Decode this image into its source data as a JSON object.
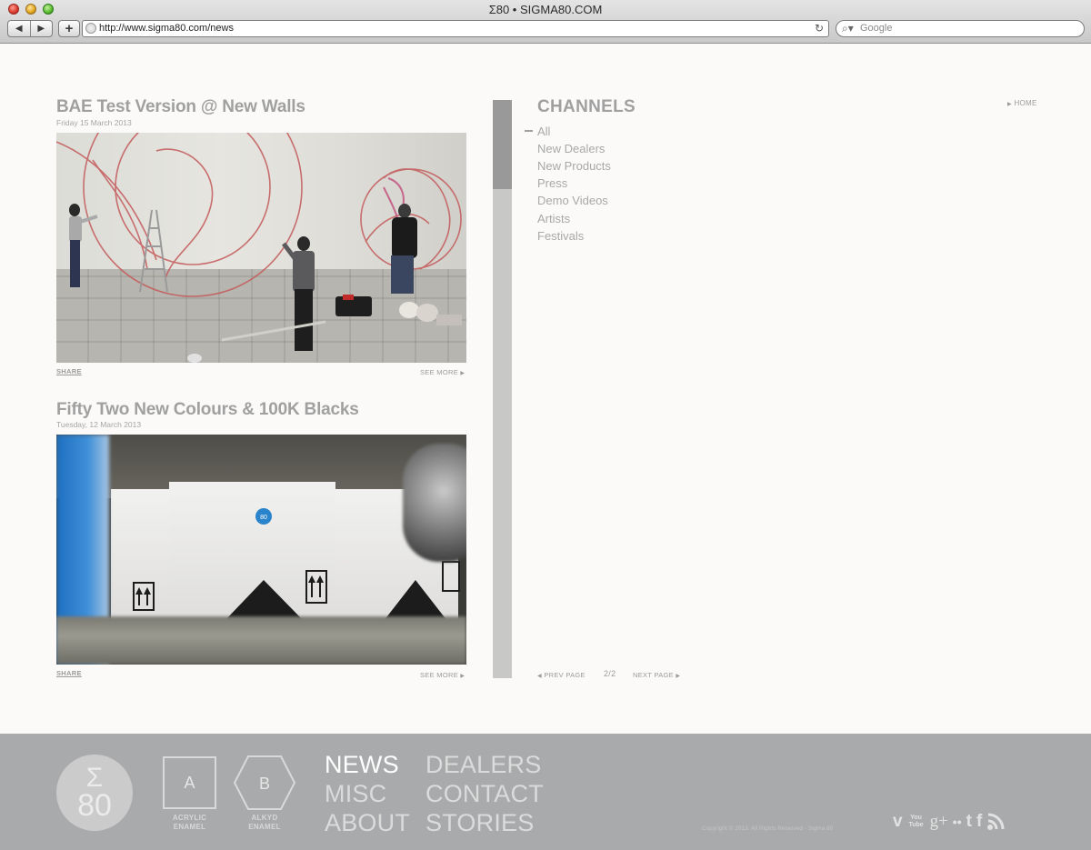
{
  "browser": {
    "window_title": "Σ80 • SIGMA80.COM",
    "url": "http://www.sigma80.com/news",
    "search_placeholder": "Google"
  },
  "posts": [
    {
      "title": "BAE Test Version @ New Walls",
      "date": "Friday 15 March 2013",
      "share_label": "SHARE",
      "see_more_label": "SEE MORE"
    },
    {
      "title": "Fifty Two New Colours & 100K Blacks",
      "date": "Tuesday, 12 March 2013",
      "share_label": "SHARE",
      "see_more_label": "SEE MORE"
    }
  ],
  "channels": {
    "title": "CHANNELS",
    "items": [
      "All",
      "New Dealers",
      "New Products",
      "Press",
      "Demo Videos",
      "Artists",
      "Festivals"
    ]
  },
  "home_label": "HOME",
  "pager": {
    "prev_label": "PREV PAGE",
    "page_indicator": "2/2",
    "next_label": "NEXT PAGE"
  },
  "footer": {
    "logo_symbol": "Σ",
    "logo_number": "80",
    "acrylic_letter": "A",
    "acrylic_label_1": "ACRYLIC",
    "acrylic_label_2": "ENAMEL",
    "alkyd_letter": "B",
    "alkyd_label_1": "ALKYD",
    "alkyd_label_2": "ENAMEL",
    "nav": {
      "news": "NEWS",
      "misc": "MISC",
      "about": "ABOUT",
      "dealers": "DEALERS",
      "contact": "CONTACT",
      "stories": "STORIES"
    },
    "copyright": "Copyright © 2013. All Rights Reserved - Sigma 80",
    "social": {
      "vimeo": "v",
      "youtube": "You Tube",
      "gplus": "g+",
      "flickr": "••",
      "tumblr": "t",
      "facebook": "f",
      "rss": "rss"
    }
  }
}
